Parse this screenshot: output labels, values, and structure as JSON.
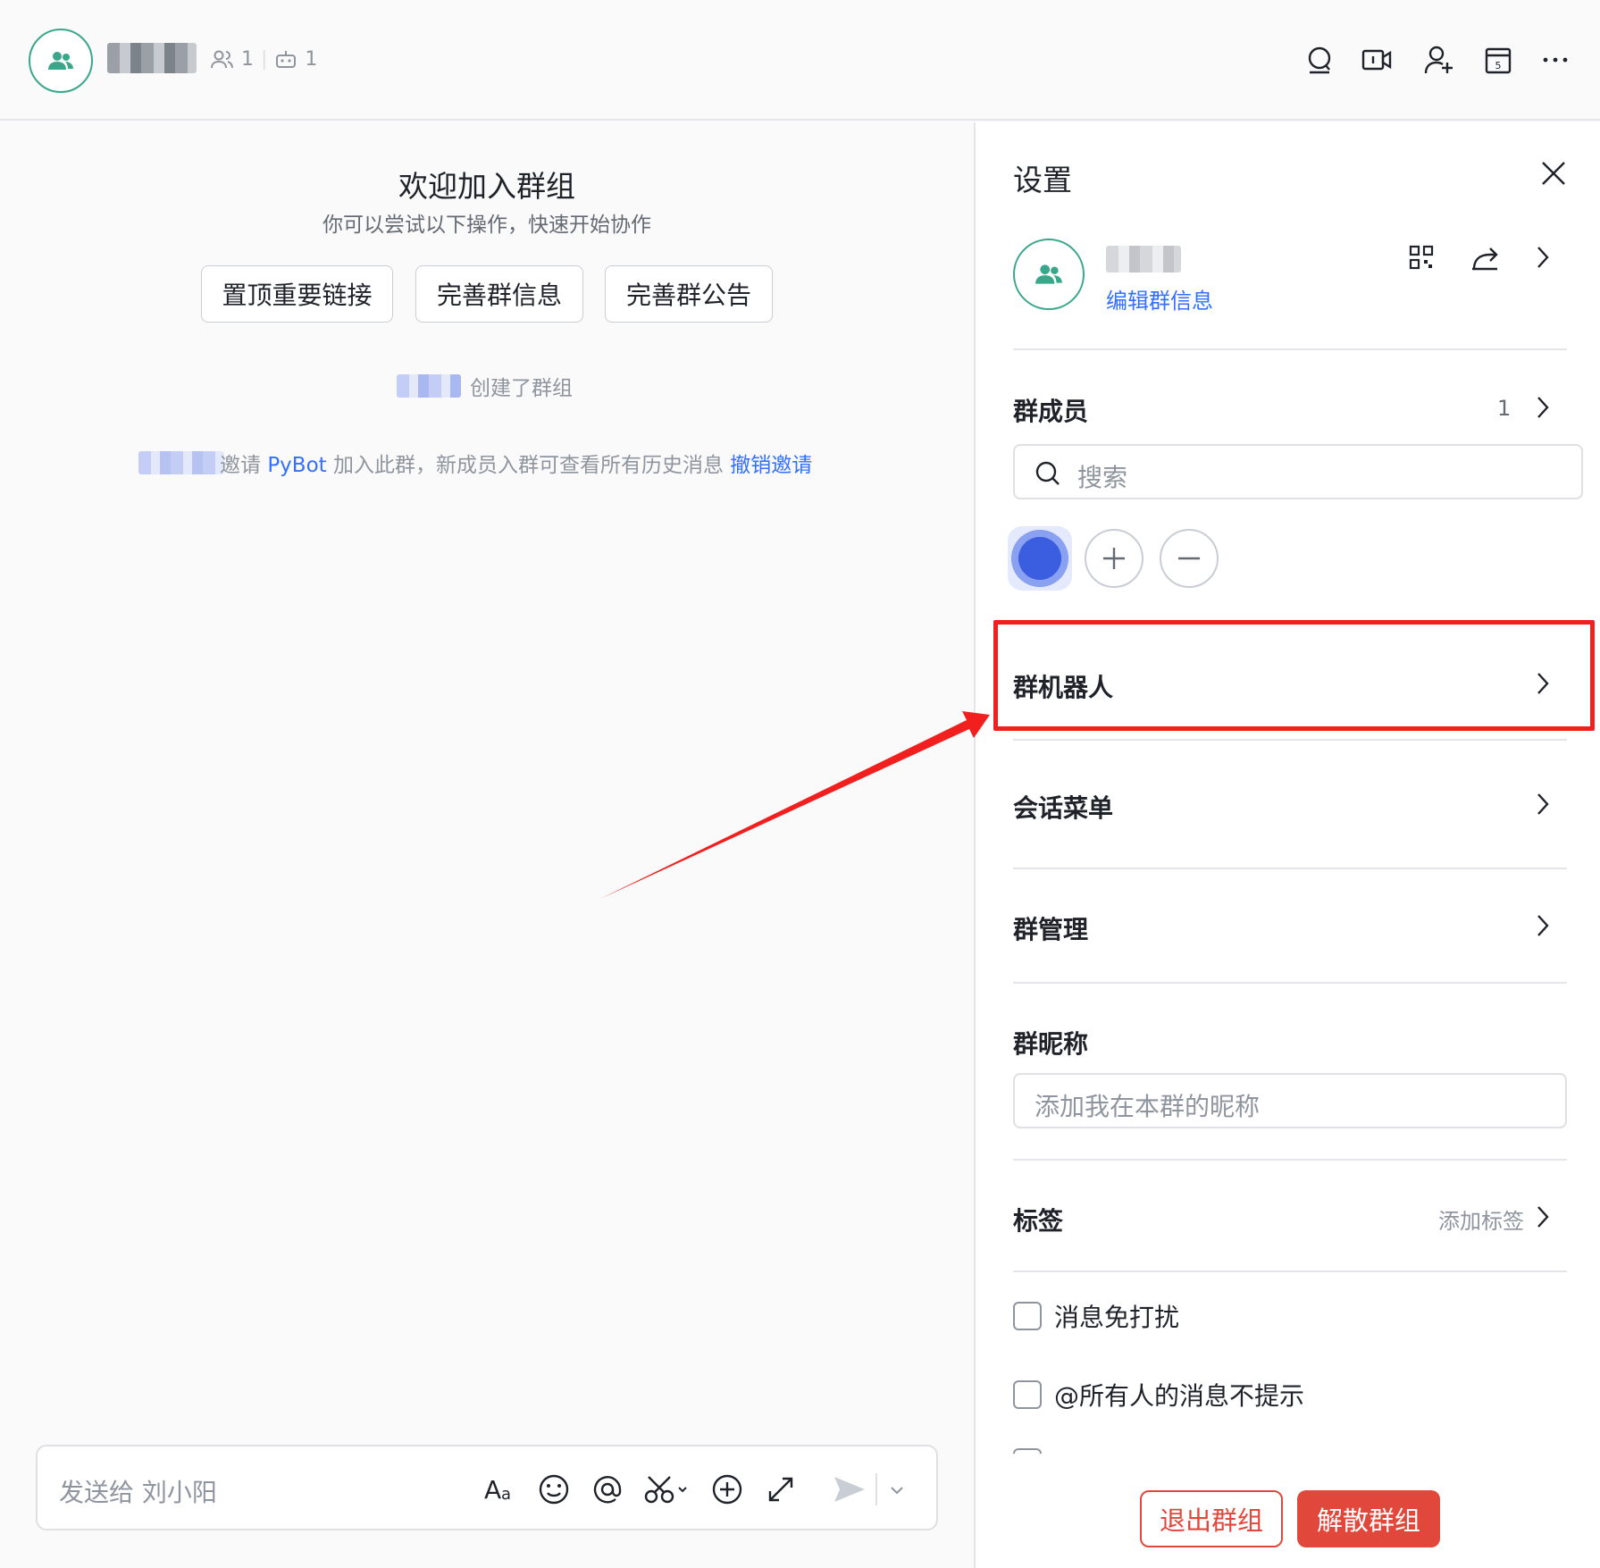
{
  "header": {
    "member_count": "1",
    "bot_count": "1"
  },
  "welcome": {
    "title": "欢迎加入群组",
    "subtitle": "你可以尝试以下操作，快速开始协作",
    "actions": [
      "置顶重要链接",
      "完善群信息",
      "完善群公告"
    ]
  },
  "system_messages": {
    "created": "创建了群组",
    "invite_prefix": "邀请 ",
    "invite_bot": "PyBot",
    "invite_suffix": " 加入此群，新成员入群可查看所有历史消息 ",
    "invite_revoke": "撤销邀请"
  },
  "composer": {
    "placeholder": "发送给 刘小阳"
  },
  "settings": {
    "title": "设置",
    "edit_group_info": "编辑群信息",
    "members_label": "群成员",
    "members_count": "1",
    "search_placeholder": "搜索",
    "rows": {
      "bots": "群机器人",
      "session_menu": "会话菜单",
      "management": "群管理",
      "nickname": "群昵称",
      "tags": "标签"
    },
    "nickname_placeholder": "添加我在本群的昵称",
    "add_tag": "添加标签",
    "checks": [
      "消息免打扰",
      "@所有人的消息不提示"
    ],
    "leave_button": "退出群组",
    "dissolve_button": "解散群组"
  },
  "colors": {
    "accent": "#3aa68a",
    "link": "#3370ff",
    "danger": "#e2473c",
    "annotation": "#f21f1f"
  }
}
